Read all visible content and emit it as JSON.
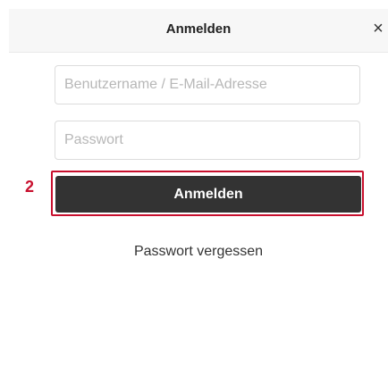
{
  "dialog": {
    "title": "Anmelden",
    "close_icon": "close-icon",
    "close_glyph": "×"
  },
  "form": {
    "username_placeholder": "Benutzername / E-Mail-Adresse",
    "password_placeholder": "Passwort",
    "username_value": "",
    "password_value": "",
    "login_button_label": "Anmelden",
    "forgot_password_label": "Passwort vergessen"
  },
  "annotation": {
    "step_number": "2",
    "highlight_color": "#c8102e"
  },
  "colors": {
    "button_background": "#333333",
    "button_text": "#ffffff",
    "header_background": "#f7f7f7"
  }
}
